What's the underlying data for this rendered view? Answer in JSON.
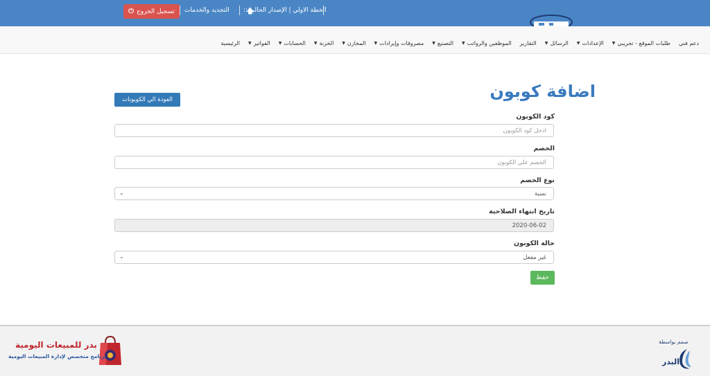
{
  "topbar": {
    "logout_label": "تسجيل الخروج",
    "renew_label": "التجديد والخدمات",
    "plan_label": "الخطة الاولي | الإصدار الحالي ::"
  },
  "nav": {
    "items": [
      {
        "label": "الرئيسية",
        "dropdown": false
      },
      {
        "label": "الفواتير",
        "dropdown": true
      },
      {
        "label": "الحسابات",
        "dropdown": true
      },
      {
        "label": "الخزنة",
        "dropdown": true
      },
      {
        "label": "المخازن",
        "dropdown": true
      },
      {
        "label": "مصروفات وإيرادات",
        "dropdown": true
      },
      {
        "label": "التصنيع",
        "dropdown": true
      },
      {
        "label": "الموظفين والرواتب",
        "dropdown": true
      },
      {
        "label": "التقارير",
        "dropdown": false
      },
      {
        "label": "الرسائل",
        "dropdown": true
      },
      {
        "label": "الإعدادات",
        "dropdown": true
      },
      {
        "label": "طلبات الموقع - تجريبي",
        "dropdown": true
      },
      {
        "label": "دعم فني",
        "dropdown": false
      }
    ]
  },
  "main": {
    "title": "اضافة كوبون",
    "back_button": "العودة الي الكوبونات",
    "fields": {
      "code": {
        "label": "كود الكوبون",
        "placeholder": "ادخل كود الكوبون"
      },
      "discount": {
        "label": "الخصم",
        "placeholder": "الخصم علي الكوبون"
      },
      "discount_type": {
        "label": "نوع الخصم",
        "value": "نسبة"
      },
      "expiry": {
        "label": "تاريخ انتهاء الصلاحية",
        "value": "2020-06-02"
      },
      "status": {
        "label": "حالة الكوبون",
        "value": "غير مفعل"
      }
    },
    "save_button": "حفظ"
  },
  "footer": {
    "brand_title": "بدر للمبيعات اليومية",
    "brand_subtitle": "برنامج متخصص لإدارة المبيعات اليومية",
    "by_label": "صمم بواسطة",
    "logo_text": "البدر"
  },
  "colors": {
    "topbar": "#4a86c5",
    "primary": "#337ab7",
    "danger": "#d9534f",
    "success": "#5cb85c",
    "title": "#3a7abf"
  }
}
